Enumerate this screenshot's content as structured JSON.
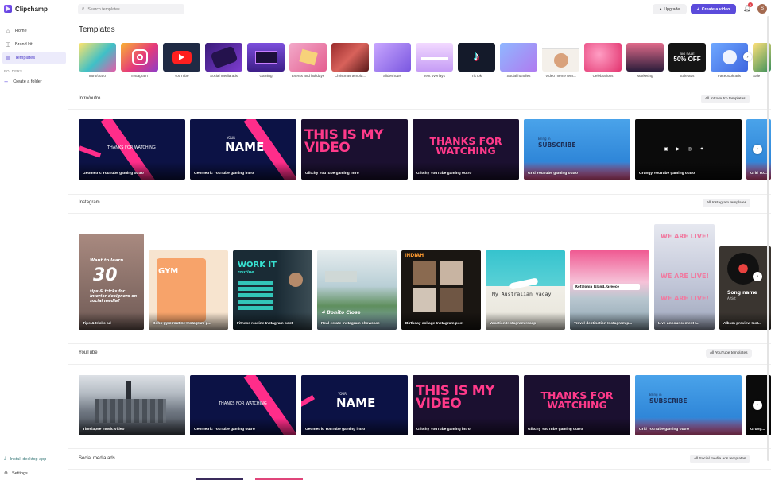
{
  "app": {
    "name": "Clipchamp"
  },
  "sidebar": {
    "items": [
      {
        "label": "Home",
        "icon": "home-icon"
      },
      {
        "label": "Brand kit",
        "icon": "brand-kit-icon"
      },
      {
        "label": "Templates",
        "icon": "templates-icon",
        "active": true
      }
    ],
    "folders_heading": "FOLDERS",
    "create_folder": "Create a folder",
    "install": "Install desktop app",
    "settings": "Settings"
  },
  "header": {
    "search_placeholder": "Search templates",
    "upgrade": "Upgrade",
    "create_video": "Create a video",
    "notification_count": "3",
    "avatar_initial": "S"
  },
  "page_title": "Templates",
  "categories": [
    "Intro/outro",
    "Instagram",
    "YouTube",
    "Social media ads",
    "Gaming",
    "Events and holidays",
    "Christmas templa...",
    "Slideshows",
    "Text overlays",
    "TikTok",
    "Social handles",
    "Video meme tem...",
    "Celebrations",
    "Marketing",
    "Sale ads",
    "Facebook ads",
    "Sale"
  ],
  "category_thumb_text": {
    "sale_ads": "50% OFF",
    "sale_ads_top": "BIG SALE"
  },
  "sections": {
    "intro_outro": {
      "title": "Intro/outro",
      "all_button": "All Intro/outro templates",
      "cards": [
        {
          "label": "Geometric YouTube gaming outro",
          "text": "THANKS FOR WATCHING"
        },
        {
          "label": "Geometric YouTube gaming intro",
          "text": "NAME",
          "small": "YOUR"
        },
        {
          "label": "Glitchy YouTube gaming intro",
          "text": "THIS IS MY VIDEO"
        },
        {
          "label": "Glitchy YouTube gaming outro",
          "text": "THANKS FOR WATCHING"
        },
        {
          "label": "Grid YouTube gaming outro",
          "text": "SUBSCRIBE",
          "small": "Bring in"
        },
        {
          "label": "Grungy YouTube gaming outro"
        },
        {
          "label": "Grid Yo..."
        }
      ]
    },
    "instagram": {
      "title": "Instagram",
      "all_button": "All Instagram templates",
      "cards": [
        {
          "label": "Tips & tricks ad",
          "text": "Want to learn",
          "big": "30",
          "sub": "tips & tricks for interior designers on social media?"
        },
        {
          "label": "Boho gym routine Instagram p...",
          "text": "GYM"
        },
        {
          "label": "Fitness routine Instagram post",
          "text": "WORK IT",
          "sub": "routine"
        },
        {
          "label": "Real estate Instagram showcase",
          "text": "4 Bonito Close"
        },
        {
          "label": "Birthday collage Instagram post",
          "text": "INDIAH"
        },
        {
          "label": "Vacation Instagram recap",
          "text": "My Australian vacay"
        },
        {
          "label": "Travel destination Instagram p...",
          "text": "Kefalonia Island, Greece"
        },
        {
          "label": "Live announcement I...",
          "text": "WE ARE LIVE!"
        },
        {
          "label": "Album preview Inst...",
          "text": "Song name",
          "sub": "Artist"
        }
      ]
    },
    "youtube": {
      "title": "YouTube",
      "all_button": "All YouTube templates",
      "cards": [
        {
          "label": "Timelapse music video"
        },
        {
          "label": "Geometric YouTube gaming outro",
          "text": "THANKS FOR WATCHING"
        },
        {
          "label": "Geometric YouTube gaming intro",
          "text": "NAME",
          "small": "YOUR"
        },
        {
          "label": "Glitchy YouTube gaming intro",
          "text": "THIS IS MY VIDEO"
        },
        {
          "label": "Glitchy YouTube gaming outro",
          "text": "THANKS FOR WATCHING"
        },
        {
          "label": "Grid YouTube gaming outro",
          "text": "SUBSCRIBE",
          "small": "Bring in"
        },
        {
          "label": "Grung..."
        }
      ]
    },
    "social_media_ads": {
      "title": "Social media ads",
      "all_button": "All Social media ads templates"
    }
  }
}
